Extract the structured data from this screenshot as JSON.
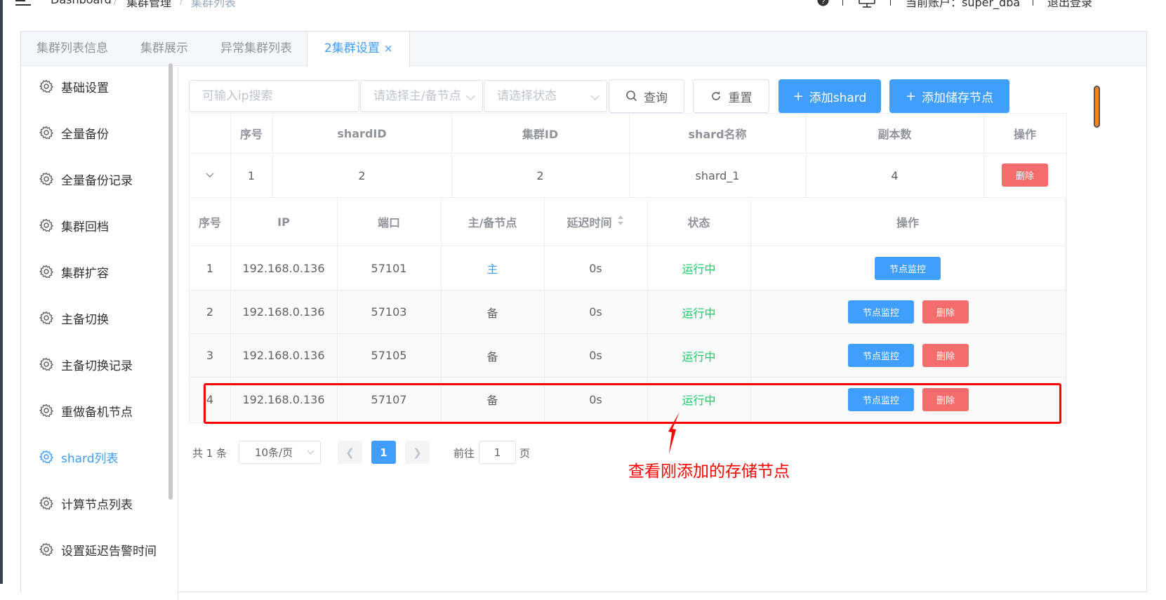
{
  "header": {
    "breadcrumb": [
      "Dashboard",
      "集群管理",
      "集群列表"
    ],
    "breadcrumb_sep": "/",
    "account_label": "当前账户：super_dba",
    "logout_label": "退出登录",
    "icons": [
      "menu-icon",
      "question-icon",
      "monitor-icon"
    ]
  },
  "tabs": [
    {
      "label": "集群列表信息"
    },
    {
      "label": "集群展示"
    },
    {
      "label": "异常集群列表"
    },
    {
      "label": "2集群设置",
      "close": "×",
      "active": true
    }
  ],
  "menu": [
    {
      "label": "基础设置"
    },
    {
      "label": "全量备份"
    },
    {
      "label": "全量备份记录"
    },
    {
      "label": "集群回档"
    },
    {
      "label": "集群扩容"
    },
    {
      "label": "主备切换"
    },
    {
      "label": "主备切换记录"
    },
    {
      "label": "重做备机节点"
    },
    {
      "label": "shard列表",
      "active": true
    },
    {
      "label": "计算节点列表"
    },
    {
      "label": "设置延迟告警时间"
    }
  ],
  "filters": {
    "ip_placeholder": "可输入ip搜索",
    "role_placeholder": "请选择主/备节点",
    "status_placeholder": "请选择状态",
    "query_label": "查询",
    "reset_label": "重置",
    "add_shard_label": "添加shard",
    "add_storage_label": "添加储存节点"
  },
  "shard_table": {
    "headers": [
      "序号",
      "shardID",
      "集群ID",
      "shard名称",
      "副本数",
      "操作"
    ],
    "rows": [
      {
        "index": "1",
        "shard_id": "2",
        "cluster_id": "2",
        "name": "shard_1",
        "replicas": "4",
        "delete": "删除"
      }
    ]
  },
  "node_table": {
    "headers": [
      "序号",
      "IP",
      "端口",
      "主/备节点",
      "延迟时间",
      "状态",
      "操作"
    ],
    "rows": [
      {
        "index": "1",
        "ip": "192.168.0.136",
        "port": "57101",
        "role": "主",
        "delay": "0s",
        "status": "运行中",
        "monitor": "节点监控"
      },
      {
        "index": "2",
        "ip": "192.168.0.136",
        "port": "57103",
        "role": "备",
        "delay": "0s",
        "status": "运行中",
        "monitor": "节点监控",
        "delete": "删除"
      },
      {
        "index": "3",
        "ip": "192.168.0.136",
        "port": "57105",
        "role": "备",
        "delay": "0s",
        "status": "运行中",
        "monitor": "节点监控",
        "delete": "删除"
      },
      {
        "index": "4",
        "ip": "192.168.0.136",
        "port": "57107",
        "role": "备",
        "delay": "0s",
        "status": "运行中",
        "monitor": "节点监控",
        "delete": "删除"
      }
    ]
  },
  "pagination": {
    "total": "共 1 条",
    "page_size": "10条/页",
    "current_page": "1",
    "goto_prefix": "前往",
    "goto_value": "1",
    "goto_suffix": "页"
  },
  "annotation": {
    "text": "查看刚添加的存储节点"
  },
  "colors": {
    "primary": "#409eff",
    "danger": "#f56c6c",
    "success": "#13ce66",
    "annotation": "#ff0000"
  }
}
